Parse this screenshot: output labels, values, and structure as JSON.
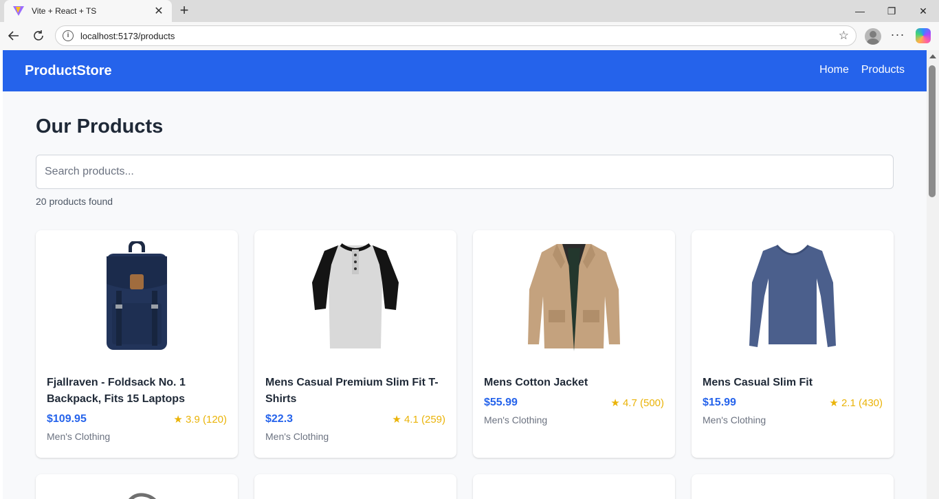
{
  "browser": {
    "tab_title": "Vite + React + TS",
    "url": "localhost:5173/products"
  },
  "navbar": {
    "brand": "ProductStore",
    "links": [
      "Home",
      "Products"
    ],
    "color": "#2563eb"
  },
  "page": {
    "title": "Our Products",
    "search_placeholder": "Search products...",
    "count_text": "20 products found"
  },
  "products": [
    {
      "name": "Fjallraven - Foldsack No. 1 Backpack, Fits 15 Laptops",
      "price": "$109.95",
      "rating": "★ 3.9 (120)",
      "category": "Men's Clothing",
      "image": "backpack"
    },
    {
      "name": "Mens Casual Premium Slim Fit T-Shirts",
      "price": "$22.3",
      "rating": "★ 4.1 (259)",
      "category": "Men's Clothing",
      "image": "henley-shirt"
    },
    {
      "name": "Mens Cotton Jacket",
      "price": "$55.99",
      "rating": "★ 4.7 (500)",
      "category": "Men's Clothing",
      "image": "jacket"
    },
    {
      "name": "Mens Casual Slim Fit",
      "price": "$15.99",
      "rating": "★ 2.1 (430)",
      "category": "Men's Clothing",
      "image": "long-sleeve-shirt"
    }
  ]
}
